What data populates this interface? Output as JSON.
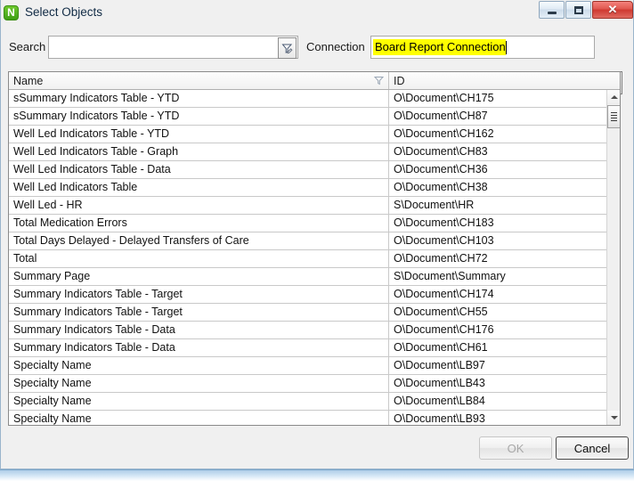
{
  "window": {
    "title": "Select Objects",
    "app_icon": "N",
    "controls": {
      "minimize": "minimize-icon",
      "maximize": "maximize-icon",
      "close": "✕"
    }
  },
  "toolbar": {
    "search_label": "Search",
    "search_value": "",
    "search_placeholder": "",
    "search_filter_icon": "funnel-filter-icon",
    "connection_label": "Connection",
    "connection_value": "Board Report Connection",
    "connection_highlight_color": "#ffff00",
    "refresh_icon": "refresh-icon",
    "refresh_color": "#2fb432"
  },
  "table": {
    "columns": [
      "Name",
      "ID"
    ],
    "sort_indicator_icon": "funnel-filter-icon",
    "rows": [
      {
        "name": "sSummary Indicators Table - YTD",
        "id": "O\\Document\\CH175"
      },
      {
        "name": "sSummary Indicators Table - YTD",
        "id": "O\\Document\\CH87"
      },
      {
        "name": "Well Led Indicators Table - YTD",
        "id": "O\\Document\\CH162"
      },
      {
        "name": "Well Led Indicators Table - Graph",
        "id": "O\\Document\\CH83"
      },
      {
        "name": "Well Led Indicators Table - Data",
        "id": "O\\Document\\CH36"
      },
      {
        "name": "Well Led Indicators Table",
        "id": "O\\Document\\CH38"
      },
      {
        "name": "Well Led - HR",
        "id": "S\\Document\\HR"
      },
      {
        "name": "Total Medication Errors",
        "id": "O\\Document\\CH183"
      },
      {
        "name": "Total Days Delayed - Delayed Transfers of Care",
        "id": "O\\Document\\CH103"
      },
      {
        "name": "Total",
        "id": "O\\Document\\CH72"
      },
      {
        "name": "Summary Page",
        "id": "S\\Document\\Summary"
      },
      {
        "name": "Summary Indicators Table - Target",
        "id": "O\\Document\\CH174"
      },
      {
        "name": "Summary Indicators Table - Target",
        "id": "O\\Document\\CH55"
      },
      {
        "name": "Summary Indicators Table - Data",
        "id": "O\\Document\\CH176"
      },
      {
        "name": "Summary Indicators Table - Data",
        "id": "O\\Document\\CH61"
      },
      {
        "name": "Specialty Name",
        "id": "O\\Document\\LB97"
      },
      {
        "name": "Specialty Name",
        "id": "O\\Document\\LB43"
      },
      {
        "name": "Specialty Name",
        "id": "O\\Document\\LB84"
      },
      {
        "name": "Specialty Name",
        "id": "O\\Document\\LB93"
      }
    ]
  },
  "footer": {
    "ok_label": "OK",
    "cancel_label": "Cancel"
  }
}
